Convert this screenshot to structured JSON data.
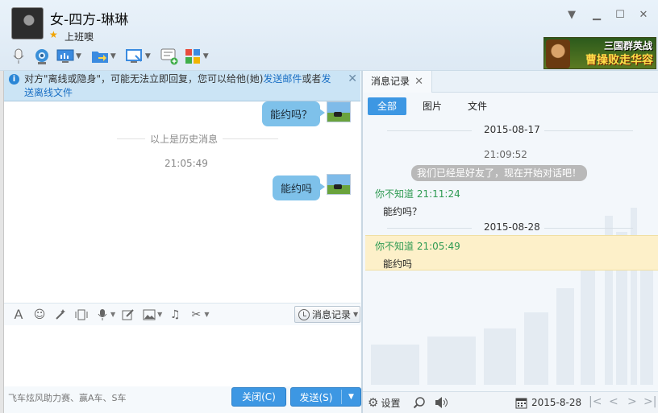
{
  "header": {
    "contact_name": "女-四方-琳琳",
    "status_signature": "上班噢",
    "window_controls": [
      "minimize",
      "maximize",
      "close"
    ],
    "toolbar_icons": [
      "microphone-icon",
      "video-call-icon",
      "remote-assist-icon",
      "file-transfer-icon",
      "screen-share-icon",
      "new-chat-icon",
      "apps-icon"
    ]
  },
  "ad": {
    "top_text": "三国群英战",
    "main_text": "曹操败走华容"
  },
  "notice": {
    "text_before": "对方\"离线或隐身\"，可能无法立即回复，您可以给他(她)",
    "link1": "发送邮件",
    "text_mid": "或者",
    "link2": "发送离线文件"
  },
  "chat": {
    "messages": [
      {
        "text": "能约吗？"
      },
      {
        "text": "能约吗"
      }
    ],
    "history_divider": "以上是历史消息",
    "time": "21:05:49"
  },
  "input_toolbar": {
    "history_label": "消息记录"
  },
  "footer": {
    "promo": "飞车炫风助力赛、赢A车、S车",
    "close_label": "关闭(C)",
    "send_label": "发送(S)"
  },
  "history_panel": {
    "tab_label": "消息记录",
    "filters": [
      "全部",
      "图片",
      "文件"
    ],
    "date1": "2015-08-17",
    "time1": "21:09:52",
    "system_message": "我们已经是好友了，现在开始对话吧！",
    "entries": [
      {
        "sender": "你不知道",
        "time": "21:11:24",
        "text": "能约吗？"
      },
      {
        "sender": "你不知道",
        "time": "21:05:49",
        "text": "能约吗"
      }
    ],
    "date2": "2015-08-28",
    "settings_label": "设置",
    "current_date": "2015-8-28"
  },
  "colors": {
    "accent": "#3d97e3",
    "bubble": "#7ec1ea",
    "sender_green": "#2e9a52",
    "highlight": "#fdf0c9"
  }
}
